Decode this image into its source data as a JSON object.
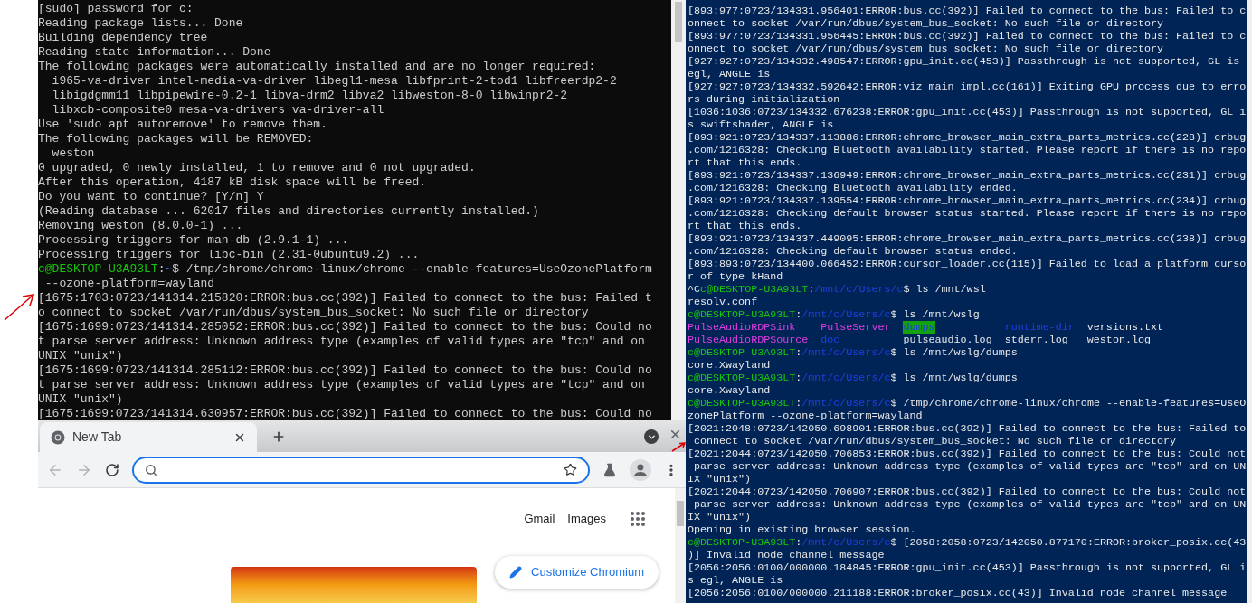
{
  "left_terminal": {
    "lines": [
      {
        "kind": "text",
        "text": "[sudo] password for c:"
      },
      {
        "kind": "text",
        "text": "Reading package lists... Done"
      },
      {
        "kind": "text",
        "text": "Building dependency tree"
      },
      {
        "kind": "text",
        "text": "Reading state information... Done"
      },
      {
        "kind": "text",
        "text": "The following packages were automatically installed and are no longer required:"
      },
      {
        "kind": "text",
        "text": "  i965-va-driver intel-media-va-driver libegl1-mesa libfprint-2-tod1 libfreerdp2-2"
      },
      {
        "kind": "text",
        "text": "  libigdgmm11 libpipewire-0.2-1 libva-drm2 libva2 libweston-8-0 libwinpr2-2"
      },
      {
        "kind": "text",
        "text": "  libxcb-composite0 mesa-va-drivers va-driver-all"
      },
      {
        "kind": "text",
        "text": "Use 'sudo apt autoremove' to remove them."
      },
      {
        "kind": "text",
        "text": "The following packages will be REMOVED:"
      },
      {
        "kind": "text",
        "text": "  weston"
      },
      {
        "kind": "text",
        "text": "0 upgraded, 0 newly installed, 1 to remove and 0 not upgraded."
      },
      {
        "kind": "text",
        "text": "After this operation, 4187 kB disk space will be freed."
      },
      {
        "kind": "text",
        "text": "Do you want to continue? [Y/n] Y"
      },
      {
        "kind": "text",
        "text": "(Reading database ... 62017 files and directories currently installed.)"
      },
      {
        "kind": "text",
        "text": "Removing weston (8.0.0-1) ..."
      },
      {
        "kind": "text",
        "text": "Processing triggers for man-db (2.9.1-1) ..."
      },
      {
        "kind": "text",
        "text": "Processing triggers for libc-bin (2.31-0ubuntu9.2) ..."
      },
      {
        "kind": "prompt",
        "user": "c@DESKTOP-U3A93LT",
        "separator": ":",
        "path": "~",
        "command": "$ /tmp/chrome/chrome-linux/chrome --enable-features=UseOzonePlatform"
      },
      {
        "kind": "text",
        "text": " --ozone-platform=wayland"
      },
      {
        "kind": "text",
        "text": "[1675:1703:0723/141314.215820:ERROR:bus.cc(392)] Failed to connect to the bus: Failed t"
      },
      {
        "kind": "text",
        "text": "o connect to socket /var/run/dbus/system_bus_socket: No such file or directory"
      },
      {
        "kind": "text",
        "text": "[1675:1699:0723/141314.285052:ERROR:bus.cc(392)] Failed to connect to the bus: Could no"
      },
      {
        "kind": "text",
        "text": "t parse server address: Unknown address type (examples of valid types are \"tcp\" and on"
      },
      {
        "kind": "text",
        "text": "UNIX \"unix\")"
      },
      {
        "kind": "text",
        "text": "[1675:1699:0723/141314.285112:ERROR:bus.cc(392)] Failed to connect to the bus: Could no"
      },
      {
        "kind": "text",
        "text": "t parse server address: Unknown address type (examples of valid types are \"tcp\" and on"
      },
      {
        "kind": "text",
        "text": "UNIX \"unix\")"
      },
      {
        "kind": "text",
        "text": "[1675:1699:0723/141314.630957:ERROR:bus.cc(392)] Failed to connect to the bus: Could no"
      }
    ]
  },
  "browser": {
    "tabs": [
      {
        "label": "New Tab",
        "selected": true
      }
    ],
    "back": {
      "disabled": true
    },
    "forward": {
      "disabled": true
    },
    "omnibox": {
      "focused": true
    },
    "links": [
      "Gmail",
      "Images"
    ],
    "customize_button": "Customize Chromium"
  },
  "right_terminal": {
    "lines": [
      {
        "kind": "text",
        "text": "[893:977:0723/134331.956401:ERROR:bus.cc(392)] Failed to connect to the bus: Failed to c"
      },
      {
        "kind": "text",
        "text": "onnect to socket /var/run/dbus/system_bus_socket: No such file or directory"
      },
      {
        "kind": "text",
        "text": "[893:977:0723/134331.956445:ERROR:bus.cc(392)] Failed to connect to the bus: Failed to c"
      },
      {
        "kind": "text",
        "text": "onnect to socket /var/run/dbus/system_bus_socket: No such file or directory"
      },
      {
        "kind": "text",
        "text": "[927:927:0723/134332.498547:ERROR:gpu_init.cc(453)] Passthrough is not supported, GL is"
      },
      {
        "kind": "text",
        "text": "egl, ANGLE is"
      },
      {
        "kind": "text",
        "text": "[927:927:0723/134332.592642:ERROR:viz_main_impl.cc(161)] Exiting GPU process due to erro"
      },
      {
        "kind": "text",
        "text": "rs during initialization"
      },
      {
        "kind": "text",
        "text": "[1036:1036:0723/134332.676238:ERROR:gpu_init.cc(453)] Passthrough is not supported, GL i"
      },
      {
        "kind": "text",
        "text": "s swiftshader, ANGLE is"
      },
      {
        "kind": "text",
        "text": "[893:921:0723/134337.113886:ERROR:chrome_browser_main_extra_parts_metrics.cc(228)] crbug"
      },
      {
        "kind": "text",
        "text": ".com/1216328: Checking Bluetooth availability started. Please report if there is no repo"
      },
      {
        "kind": "text",
        "text": "rt that this ends."
      },
      {
        "kind": "text",
        "text": "[893:921:0723/134337.136949:ERROR:chrome_browser_main_extra_parts_metrics.cc(231)] crbug"
      },
      {
        "kind": "text",
        "text": ".com/1216328: Checking Bluetooth availability ended."
      },
      {
        "kind": "text",
        "text": "[893:921:0723/134337.139554:ERROR:chrome_browser_main_extra_parts_metrics.cc(234)] crbug"
      },
      {
        "kind": "text",
        "text": ".com/1216328: Checking default browser status started. Please report if there is no repo"
      },
      {
        "kind": "text",
        "text": "rt that this ends."
      },
      {
        "kind": "text",
        "text": "[893:921:0723/134337.449095:ERROR:chrome_browser_main_extra_parts_metrics.cc(238)] crbug"
      },
      {
        "kind": "text",
        "text": ".com/1216328: Checking default browser status ended."
      },
      {
        "kind": "text",
        "text": "[893:893:0723/134400.066452:ERROR:cursor_loader.cc(115)] Failed to load a platform curso"
      },
      {
        "kind": "text",
        "text": "r of type kHand"
      },
      {
        "kind": "prompt",
        "prefix": "^C",
        "user": "c@DESKTOP-U3A93LT",
        "separator": ":",
        "path": "/mnt/c/Users/c",
        "command": "$ ls /mnt/wsl"
      },
      {
        "kind": "text",
        "text": "resolv.conf"
      },
      {
        "kind": "prompt",
        "user": "c@DESKTOP-U3A93LT",
        "separator": ":",
        "path": "/mnt/c/Users/c",
        "command": "$ ls /mnt/wslg"
      },
      {
        "kind": "listing",
        "entries": [
          {
            "text": "PulseAudioRDPSink",
            "kind": "link"
          },
          {
            "text": "PulseServer",
            "kind": "link"
          },
          {
            "text": "dumps",
            "kind": "dir_highlight"
          },
          {
            "text": "runtime-dir",
            "kind": "dir"
          },
          {
            "text": "versions.txt",
            "kind": "file"
          }
        ]
      },
      {
        "kind": "listing",
        "entries": [
          {
            "text": "PulseAudioRDPSource",
            "kind": "link"
          },
          {
            "text": "doc",
            "kind": "dir"
          },
          {
            "text": "pulseaudio.log",
            "kind": "file"
          },
          {
            "text": "stderr.log",
            "kind": "file"
          },
          {
            "text": "weston.log",
            "kind": "file"
          }
        ]
      },
      {
        "kind": "prompt",
        "user": "c@DESKTOP-U3A93LT",
        "separator": ":",
        "path": "/mnt/c/Users/c",
        "command": "$ ls /mnt/wslg/dumps"
      },
      {
        "kind": "text",
        "text": "core.Xwayland"
      },
      {
        "kind": "prompt",
        "user": "c@DESKTOP-U3A93LT",
        "separator": ":",
        "path": "/mnt/c/Users/c",
        "command": "$ ls /mnt/wslg/dumps"
      },
      {
        "kind": "text",
        "text": "core.Xwayland"
      },
      {
        "kind": "prompt",
        "user": "c@DESKTOP-U3A93LT",
        "separator": ":",
        "path": "/mnt/c/Users/c",
        "command": "$ /tmp/chrome/chrome-linux/chrome --enable-features=UseO"
      },
      {
        "kind": "text",
        "text": "zonePlatform --ozone-platform=wayland"
      },
      {
        "kind": "text",
        "text": "[2021:2048:0723/142050.698901:ERROR:bus.cc(392)] Failed to connect to the bus: Failed to"
      },
      {
        "kind": "text",
        "text": " connect to socket /var/run/dbus/system_bus_socket: No such file or directory"
      },
      {
        "kind": "text",
        "text": "[2021:2044:0723/142050.706853:ERROR:bus.cc(392)] Failed to connect to the bus: Could not"
      },
      {
        "kind": "text",
        "text": " parse server address: Unknown address type (examples of valid types are \"tcp\" and on UN"
      },
      {
        "kind": "text",
        "text": "IX \"unix\")"
      },
      {
        "kind": "text",
        "text": "[2021:2044:0723/142050.706907:ERROR:bus.cc(392)] Failed to connect to the bus: Could not"
      },
      {
        "kind": "text",
        "text": " parse server address: Unknown address type (examples of valid types are \"tcp\" and on UN"
      },
      {
        "kind": "text",
        "text": "IX \"unix\")"
      },
      {
        "kind": "text",
        "text": "Opening in existing browser session."
      },
      {
        "kind": "prompt",
        "user": "c@DESKTOP-U3A93LT",
        "separator": ":",
        "path": "/mnt/c/Users/c",
        "command": "$ [2058:2058:0723/142050.877170:ERROR:broker_posix.cc(43"
      },
      {
        "kind": "text",
        "text": ")] Invalid node channel message"
      },
      {
        "kind": "text",
        "text": "[2056:2056:0100/000000.184845:ERROR:gpu_init.cc(453)] Passthrough is not supported, GL i"
      },
      {
        "kind": "text",
        "text": "s egl, ANGLE is"
      },
      {
        "kind": "text",
        "text": "[2056:2056:0100/000000.211188:ERROR:broker_posix.cc(43)] Invalid node channel message"
      }
    ]
  }
}
